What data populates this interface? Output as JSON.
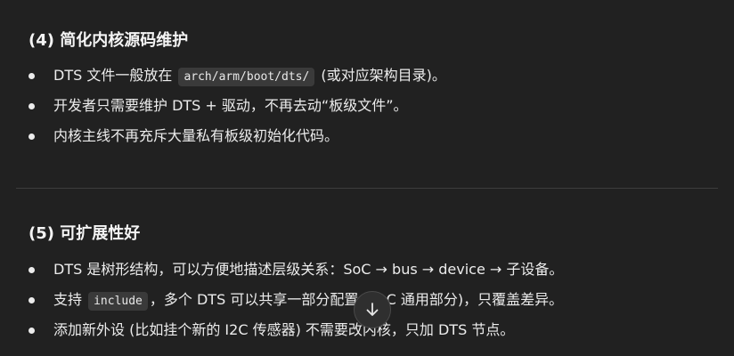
{
  "section1": {
    "heading": "(4) 简化内核源码维护",
    "bullets": [
      {
        "before": "DTS 文件一般放在 ",
        "code": "arch/arm/boot/dts/",
        "after": " (或对应架构目录)。"
      },
      {
        "text": "开发者只需要维护 DTS + 驱动，不再去动“板级文件”。"
      },
      {
        "text": "内核主线不再充斥大量私有板级初始化代码。"
      }
    ]
  },
  "section2": {
    "heading": "(5) 可扩展性好",
    "bullets": [
      {
        "text": "DTS 是树形结构，可以方便地描述层级关系：SoC → bus → device → 子设备。"
      },
      {
        "before": "支持 ",
        "code": "include",
        "after": "，多个 DTS 可以共享一部分配置 (SoC 通用部分)，只覆盖差异。"
      },
      {
        "text": "添加新外设 (比如挂个新的 I2C 传感器) 不需要改内核，只加 DTS 节点。"
      }
    ]
  },
  "scroll_button": {
    "icon": "arrow-down-icon"
  },
  "colors": {
    "background": "#212121",
    "text": "#ececec",
    "code_background": "#3a3a3a",
    "divider": "#3d3d3d",
    "button_background": "#2f2f2f"
  }
}
